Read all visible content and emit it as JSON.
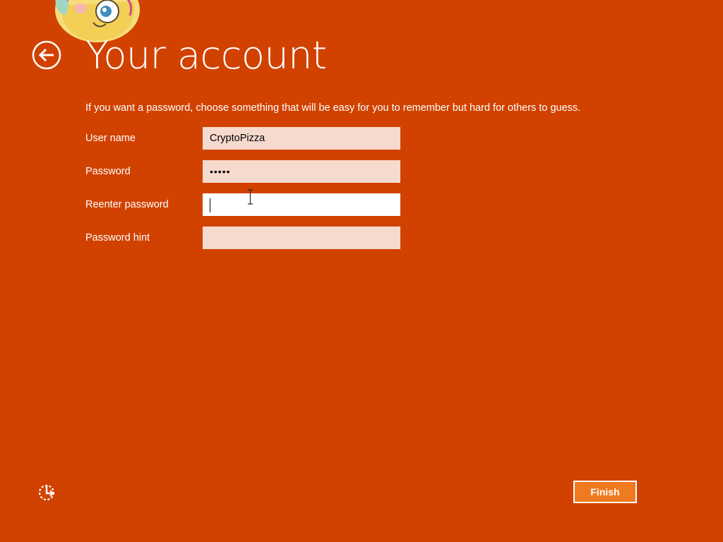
{
  "header": {
    "title": "Your account",
    "back_icon": "back-arrow-icon",
    "avatar_icon": "cartoon-avatar"
  },
  "instructions": "If you want a password, choose something that will be easy for you to remember but hard for others to guess.",
  "form": {
    "username": {
      "label": "User name",
      "value": "CryptoPizza"
    },
    "password": {
      "label": "Password",
      "value": "•••••"
    },
    "reenter_password": {
      "label": "Reenter password",
      "value": ""
    },
    "password_hint": {
      "label": "Password hint",
      "value": ""
    }
  },
  "footer": {
    "finish_label": "Finish",
    "ease_of_access_icon": "ease-of-access-icon"
  },
  "colors": {
    "background": "#d14200",
    "input_inactive": "#f6dacd",
    "input_active": "#ffffff",
    "finish_button": "#f07a1f"
  }
}
